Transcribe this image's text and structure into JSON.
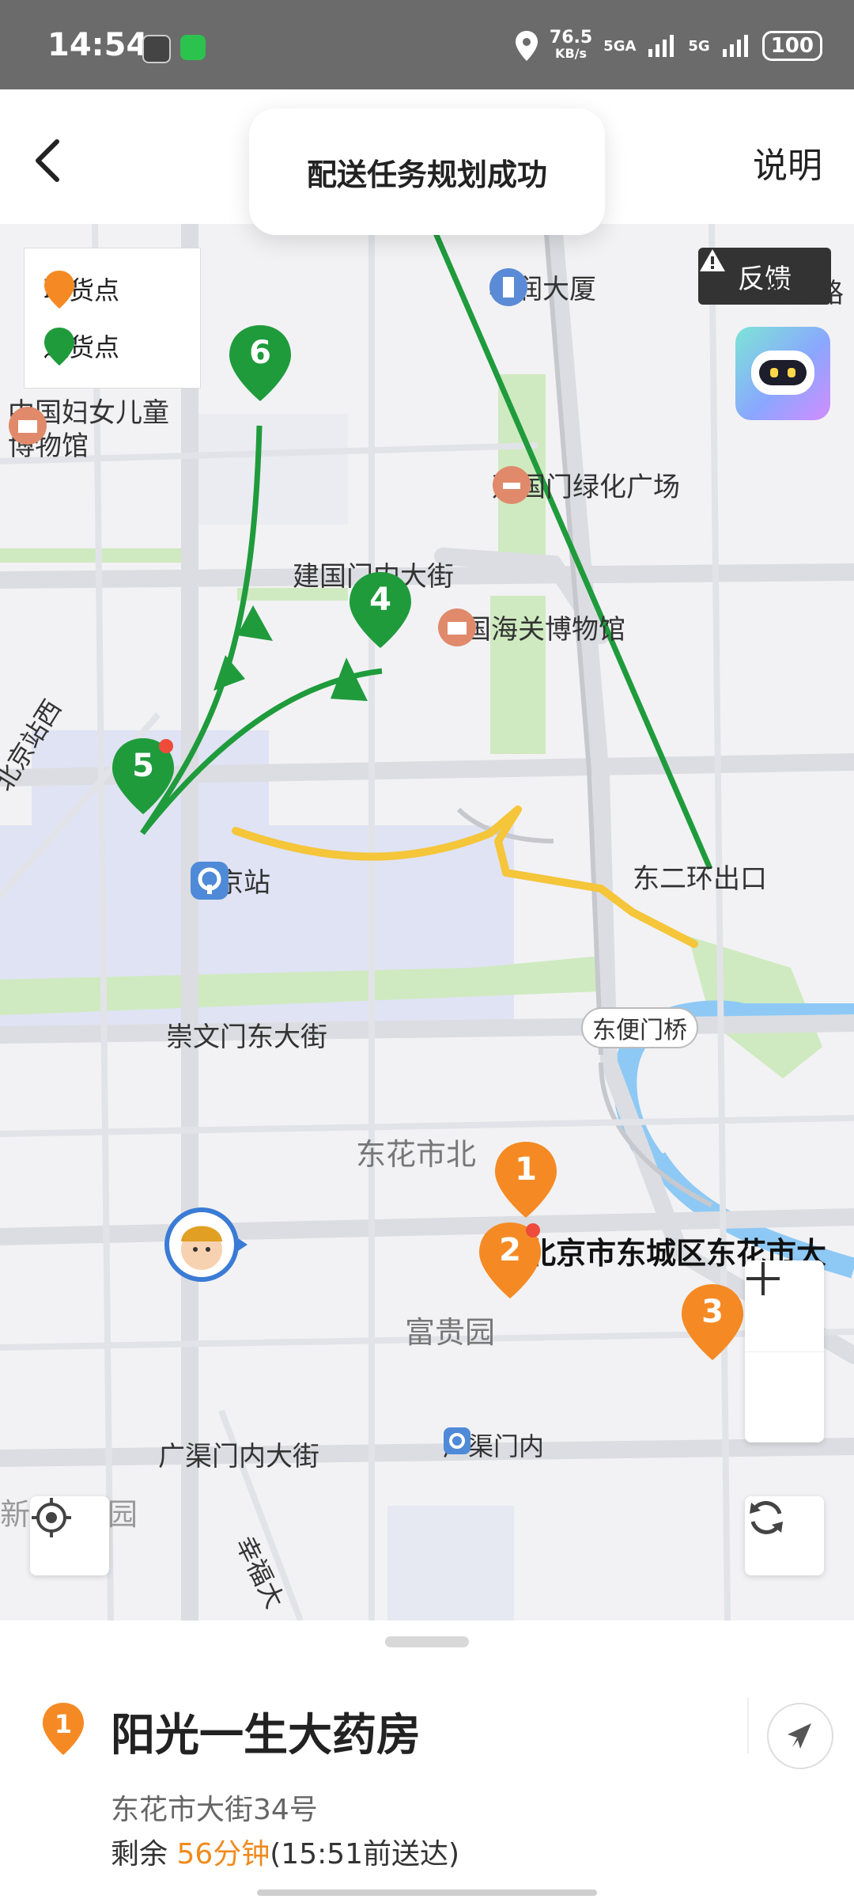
{
  "status_bar": {
    "time": "14:54",
    "net_speed_value": "76.5",
    "net_speed_unit": "KB/s",
    "signal_1": "5GA",
    "signal_2": "5G",
    "battery": "100"
  },
  "header": {
    "back_icon": "chevron-left-icon",
    "help_label": "说明",
    "toast": "配送任务规划成功"
  },
  "map": {
    "legend": {
      "pickup_label": "取货点",
      "dropoff_label": "送货点"
    },
    "feedback_label": "反馈",
    "labels": {
      "huarun": "华润大厦",
      "guanghua": "光华路",
      "women_museum_line1": "中国妇女儿童",
      "women_museum_line2": "博物馆",
      "jianguomen_square": "建国门绿化广场",
      "jianguomennei": "建国门内大街",
      "customs_museum": "中国海关博物馆",
      "beijing_station": "北京站",
      "beijingzhan_road": "北京站西",
      "ring_exit": "东二环出口",
      "dongbianmen_bridge": "东便门桥",
      "chongwenmen": "崇文门东大街",
      "donghuashi_north": "东花市北",
      "current_address": "北京市东城区东花市大",
      "fugui_garden": "富贵园",
      "guangqumen_street": "广渠门内大街",
      "guangqumen": "广渠门内",
      "xin_garden": "新",
      "xin_garden_2": "园",
      "xingfu": "幸福大"
    },
    "pins": {
      "p1": "1",
      "p2": "2",
      "p3": "3",
      "p4": "4",
      "p5": "5",
      "p6": "6"
    },
    "colors": {
      "pickup": "#f58a24",
      "dropoff": "#1f9b3c",
      "route_green": "#1f9b3c",
      "route_yellow": "#f5c53a"
    }
  },
  "sheet": {
    "badge": "1",
    "name": "阳光一生大药房",
    "address": "东花市大街34号",
    "eta_prefix": "剩余 ",
    "eta_highlight": "56分钟",
    "eta_suffix": "(15:51前送达)"
  }
}
